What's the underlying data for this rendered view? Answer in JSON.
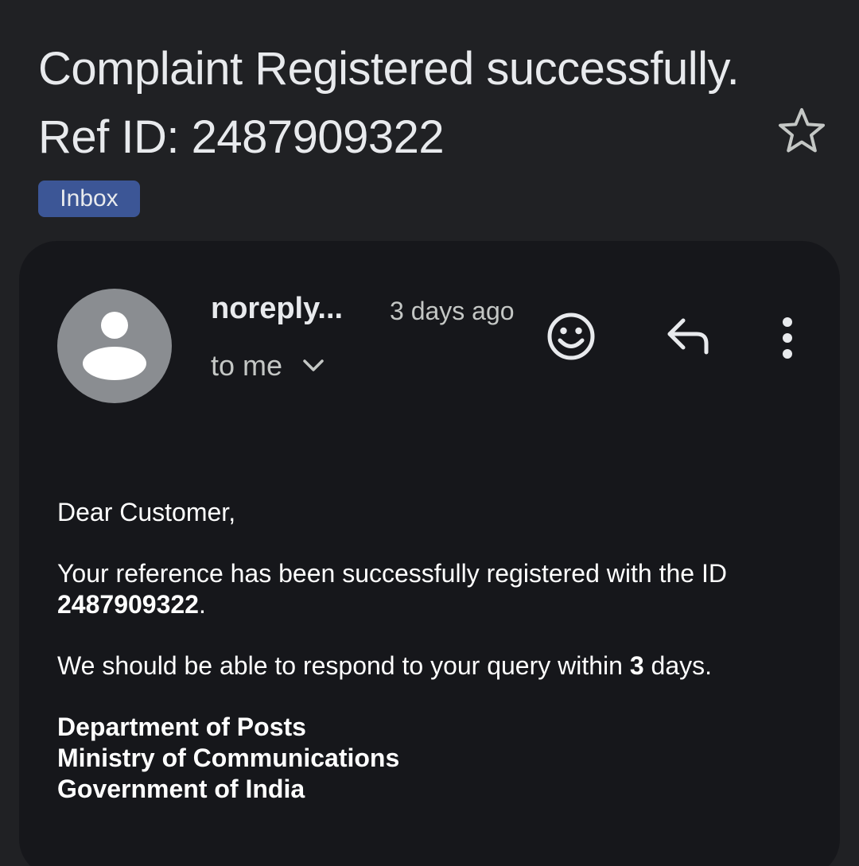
{
  "email": {
    "subject": "Complaint Registered successfully. Ref ID: 2487909322",
    "label": "Inbox",
    "sender": "noreply...",
    "time": "3 days ago",
    "recipient": "to me"
  },
  "body": {
    "greeting": "Dear Customer,",
    "para1_prefix": "Your reference has been successfully registered with the ID",
    "para1_ref_id": "2487909322",
    "para1_suffix": ".",
    "para2_prefix": "We should be able to respond to your query within",
    "para2_days": "3",
    "para2_suffix": "days.",
    "signature": [
      "Department of Posts",
      "Ministry of Communications",
      "Government of India"
    ]
  },
  "icons": {
    "star": "star-outline-icon",
    "avatar": "person-icon",
    "chevron": "chevron-down-icon",
    "emoji": "emoji-reaction-icon",
    "reply": "reply-icon",
    "more": "more-vert-icon"
  },
  "colors": {
    "background": "#202124",
    "card": "#16171b",
    "label_chip": "#3c5696",
    "avatar_bg": "#8a8d91",
    "text": "#e8eaed"
  }
}
